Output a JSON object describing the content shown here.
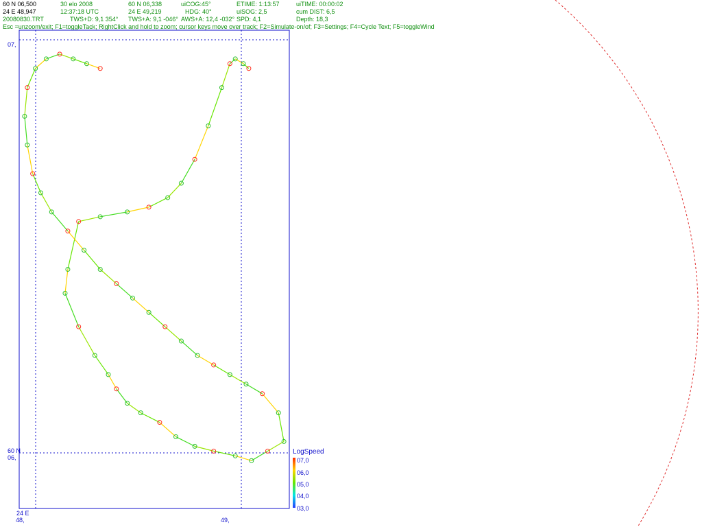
{
  "header": {
    "row1": [
      {
        "key": "lat",
        "text": "60 N 06,500"
      },
      {
        "key": "date",
        "text": "30 elo 2008"
      },
      {
        "key": "lat2",
        "text": "60 N 06,338"
      },
      {
        "key": "uicog",
        "text": "uiCOG:45°"
      },
      {
        "key": "etime",
        "text": "ETIME: 1:13:57"
      },
      {
        "key": "uitime",
        "text": "uiTIME: 00:00:02"
      }
    ],
    "row2": [
      {
        "key": "lon",
        "text": "24 E 48,947"
      },
      {
        "key": "time",
        "text": "12:37:18  UTC"
      },
      {
        "key": "lon2",
        "text": "24 E 49,219"
      },
      {
        "key": "hdg",
        "text": "HDG: 40°"
      },
      {
        "key": "uisog",
        "text": "uiSOG: 2,5"
      },
      {
        "key": "cumdist",
        "text": "cum DIST: 6,5"
      }
    ],
    "row3": [
      {
        "key": "file",
        "text": "20080830.TRT"
      },
      {
        "key": "twsd",
        "text": "TWS+D: 9,1 354°"
      },
      {
        "key": "twsa",
        "text": "TWS+A: 9,1 -046°"
      },
      {
        "key": "awsa",
        "text": "AWS+A: 12,4 -032°"
      },
      {
        "key": "spd",
        "text": "SPD: 4,1"
      },
      {
        "key": "depth",
        "text": "Depth: 18,3"
      }
    ],
    "help": "Esc =unzoom/exit; F1=toggleTack; RightClick and hold to zoom; cursor keys move over track; F2=Simulate-on/of; F3=Settings; F4=Cycle Text; F5=toggleWind",
    "colors": {
      "dark": "#000000",
      "green": "#109010",
      "blue": "#1010cc"
    }
  },
  "axes": {
    "top_lat": "07,",
    "bottom_lat_prefix": "60 N",
    "bottom_lat": "06,",
    "lon_prefix": "24 E",
    "lon_left": "48,",
    "lon_right": "49,"
  },
  "legend": {
    "title": "LogSpeed",
    "ticks": [
      "07,0",
      "06,0",
      "05,0",
      "04,0",
      "03,0"
    ],
    "colors": [
      "#ff2a00",
      "#ffd400",
      "#66e600",
      "#00e6e6",
      "#2a3cff"
    ]
  },
  "chart_data": {
    "type": "scatter",
    "title": "",
    "xlabel": "",
    "ylabel": "",
    "series": [
      {
        "name": "track",
        "points": [
          [
            0.85,
            0.92
          ],
          [
            0.83,
            0.93
          ],
          [
            0.8,
            0.94
          ],
          [
            0.78,
            0.93
          ],
          [
            0.75,
            0.88
          ],
          [
            0.7,
            0.8
          ],
          [
            0.65,
            0.73
          ],
          [
            0.6,
            0.68
          ],
          [
            0.55,
            0.65
          ],
          [
            0.48,
            0.63
          ],
          [
            0.4,
            0.62
          ],
          [
            0.3,
            0.61
          ],
          [
            0.22,
            0.6
          ],
          [
            0.18,
            0.5
          ],
          [
            0.17,
            0.45
          ],
          [
            0.22,
            0.38
          ],
          [
            0.28,
            0.32
          ],
          [
            0.33,
            0.28
          ],
          [
            0.36,
            0.25
          ],
          [
            0.4,
            0.22
          ],
          [
            0.45,
            0.2
          ],
          [
            0.52,
            0.18
          ],
          [
            0.58,
            0.15
          ],
          [
            0.65,
            0.13
          ],
          [
            0.72,
            0.12
          ],
          [
            0.8,
            0.11
          ],
          [
            0.86,
            0.1
          ],
          [
            0.92,
            0.12
          ],
          [
            0.98,
            0.14
          ],
          [
            0.96,
            0.2
          ],
          [
            0.9,
            0.24
          ],
          [
            0.84,
            0.26
          ],
          [
            0.78,
            0.28
          ],
          [
            0.72,
            0.3
          ],
          [
            0.66,
            0.32
          ],
          [
            0.6,
            0.35
          ],
          [
            0.54,
            0.38
          ],
          [
            0.48,
            0.41
          ],
          [
            0.42,
            0.44
          ],
          [
            0.36,
            0.47
          ],
          [
            0.3,
            0.5
          ],
          [
            0.24,
            0.54
          ],
          [
            0.18,
            0.58
          ],
          [
            0.12,
            0.62
          ],
          [
            0.08,
            0.66
          ],
          [
            0.05,
            0.7
          ],
          [
            0.03,
            0.76
          ],
          [
            0.02,
            0.82
          ],
          [
            0.03,
            0.88
          ],
          [
            0.06,
            0.92
          ],
          [
            0.1,
            0.94
          ],
          [
            0.15,
            0.95
          ],
          [
            0.2,
            0.94
          ],
          [
            0.25,
            0.93
          ],
          [
            0.3,
            0.92
          ]
        ]
      }
    ]
  }
}
